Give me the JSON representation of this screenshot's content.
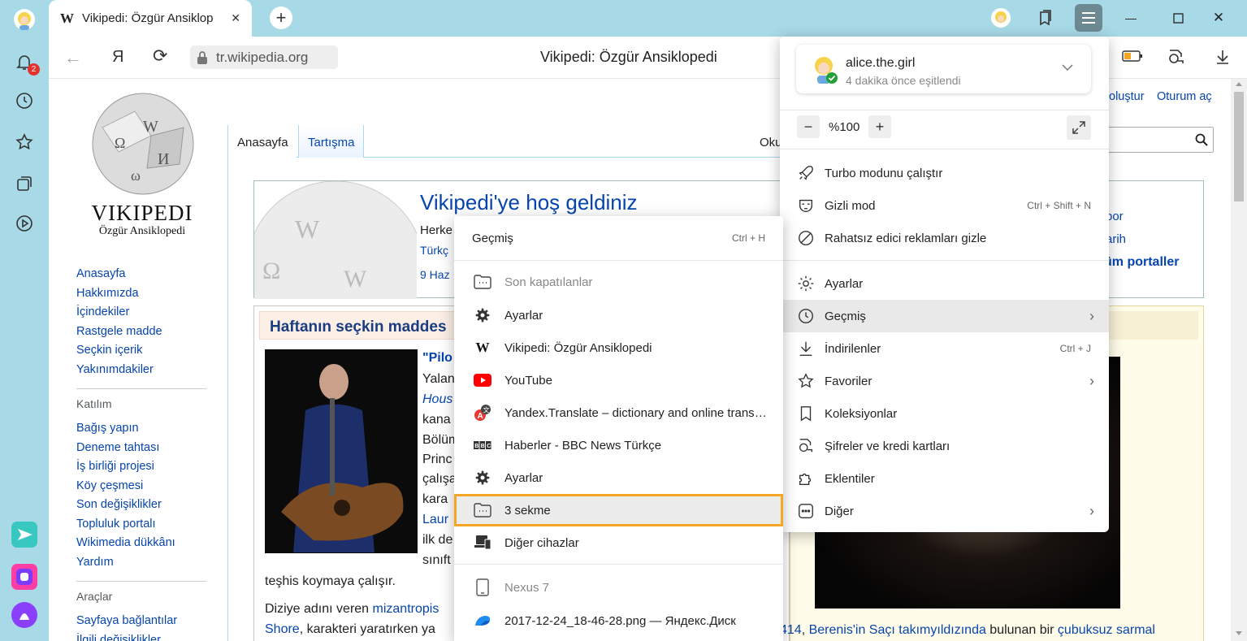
{
  "colors": {
    "accent": "#f5a623",
    "link": "#0645ad",
    "chrome": "#a7d9e6"
  },
  "sidebar": {
    "notification_badge": "2"
  },
  "tab": {
    "title": "Vikipedi: Özgür Ansiklop",
    "close": "✕",
    "new_tab": "+"
  },
  "address": {
    "back": "←",
    "yandex_logo": "Я",
    "reload": "⟳",
    "url": "tr.wikipedia.org",
    "page_title": "Vikipedi: Özgür Ansiklopedi"
  },
  "window": {
    "minimize": "—",
    "maximize": "☐",
    "close": "✕"
  },
  "wiki": {
    "logo_title": "VIKIPEDI",
    "logo_sub": "Özgür Ansiklopedi",
    "nav": [
      "Anasayfa",
      "Hakkımızda",
      "İçindekiler",
      "Rastgele madde",
      "Seçkin içerik",
      "Yakınımdakiler"
    ],
    "katilim_title": "Katılım",
    "katilim": [
      "Bağış yapın",
      "Deneme tahtası",
      "İş birliği projesi",
      "Köy çeşmesi",
      "Son değişiklikler",
      "Topluluk portalı",
      "Wikimedia dükkânı",
      "Yardım"
    ],
    "araclar_title": "Araçlar",
    "araclar": [
      "Sayfaya bağlantılar",
      "İlgili değişiklikler"
    ],
    "tabs": [
      "Anasayfa",
      "Tartışma"
    ],
    "tab_read": "Oku",
    "account": [
      "oluştur",
      "Oturum aç"
    ],
    "welcome": "Vikipedi'ye hoş geldiniz",
    "welcome_lines": [
      "Herke",
      "Türkç",
      "9 Haz"
    ],
    "portals": [
      "por",
      "arih",
      "üm portaller"
    ],
    "featured_title": "Haftanın seçkin maddes",
    "featured_lines": [
      "\"Pilo",
      "Yalan",
      "Hous",
      "kana",
      "Bölüm",
      "Princ",
      "çalışa",
      "kara",
      "Laur",
      "ilk de",
      "sınıft"
    ],
    "featured_text1": "teşhis koymaya çalışır.",
    "featured_text2a": "Diziye adını veren ",
    "featured_text2b": "mizantropis",
    "featured_text3a": "Shore",
    "featured_text3b": ", karakteri yaratırken ya",
    "bottom_right_a": "414",
    "bottom_right_b": ", ",
    "bottom_right_c": "Berenis'in Saçı takımyıldızında",
    "bottom_right_d": " bulunan bir ",
    "bottom_right_e": "çubuksuz sarmal"
  },
  "main_menu": {
    "user": {
      "name": "alice.the.girl",
      "status": "4 dakika önce eşitlendi"
    },
    "zoom": {
      "minus": "−",
      "value": "%100",
      "plus": "+"
    },
    "items1": [
      {
        "label": "Turbo modunu çalıştır",
        "icon": "rocket-icon",
        "shortcut": ""
      },
      {
        "label": "Gizli mod",
        "icon": "mask-icon",
        "shortcut": "Ctrl + Shift + N"
      },
      {
        "label": "Rahatsız edici reklamları gizle",
        "icon": "block-icon",
        "shortcut": ""
      }
    ],
    "items2": [
      {
        "label": "Ayarlar",
        "icon": "gear-icon",
        "shortcut": "",
        "arrow": ""
      },
      {
        "label": "Geçmiş",
        "icon": "clock-icon",
        "shortcut": "",
        "arrow": "›"
      },
      {
        "label": "İndirilenler",
        "icon": "download-icon",
        "shortcut": "Ctrl + J",
        "arrow": ""
      },
      {
        "label": "Favoriler",
        "icon": "star-icon",
        "shortcut": "",
        "arrow": "›"
      },
      {
        "label": "Koleksiyonlar",
        "icon": "collection-icon",
        "shortcut": "",
        "arrow": ""
      },
      {
        "label": "Şifreler ve kredi kartları",
        "icon": "key-icon",
        "shortcut": "",
        "arrow": ""
      },
      {
        "label": "Eklentiler",
        "icon": "puzzle-icon",
        "shortcut": "",
        "arrow": ""
      },
      {
        "label": "Diğer",
        "icon": "more-icon",
        "shortcut": "",
        "arrow": "›"
      }
    ]
  },
  "history_menu": {
    "title": "Geçmiş",
    "title_shortcut": "Ctrl + H",
    "recent_title": "Son kapatılanlar",
    "items": [
      {
        "label": "Ayarlar",
        "icon": "gear-icon"
      },
      {
        "label": "Vikipedi: Özgür Ansiklopedi",
        "icon": "wikipedia-icon"
      },
      {
        "label": "YouTube",
        "icon": "youtube-icon"
      },
      {
        "label": "Yandex.Translate – dictionary and online translation",
        "icon": "translate-icon"
      },
      {
        "label": "Haberler - BBC News Türkçe",
        "icon": "bbc-icon"
      },
      {
        "label": "Ayarlar",
        "icon": "gear-icon"
      },
      {
        "label": "3 sekme",
        "icon": "folder-icon"
      },
      {
        "label": "Diğer cihazlar",
        "icon": "devices-icon"
      }
    ],
    "device": "Nexus 7",
    "device_items": [
      {
        "label": "2017-12-24_18-46-28.png — Яндекс.Диск",
        "icon": "yandex-disk-icon"
      }
    ]
  }
}
